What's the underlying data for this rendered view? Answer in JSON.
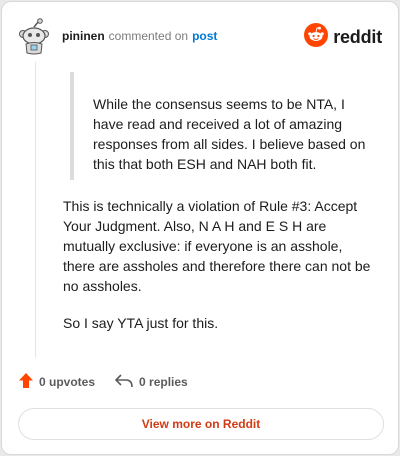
{
  "header": {
    "username": "pininen",
    "action_text": "commented on",
    "post_link": "post",
    "brand_name": "reddit"
  },
  "comment": {
    "quote": "While the consensus seems to be NTA, I have read and received a lot of amazing responses from all sides. I believe based on this that both ESH and NAH both fit.",
    "paragraph1": "This is technically a violation of Rule #3: Accept Your Judgment. Also, N A H and E S H are mutually exclusive: if everyone is an asshole, there are assholes and therefore there can not be no assholes.",
    "paragraph2": "So I say YTA just for this."
  },
  "actions": {
    "upvotes": "0 upvotes",
    "replies": "0 replies"
  },
  "footer": {
    "view_more": "View more on Reddit"
  },
  "colors": {
    "brand_orange": "#ff4500",
    "link_blue": "#0079d3",
    "button_text": "#d13b13"
  },
  "icons": {
    "avatar": "snoo-avatar",
    "brand": "reddit-logo",
    "upvote": "upvote-arrow-icon",
    "reply": "reply-icon"
  }
}
